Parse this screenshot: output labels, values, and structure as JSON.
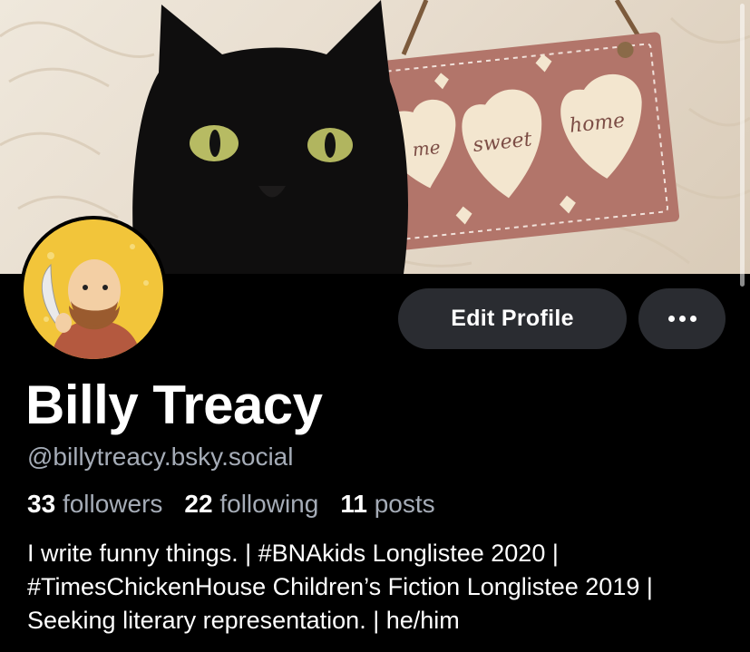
{
  "profile": {
    "display_name": "Billy Treacy",
    "handle": "@billytreacy.bsky.social",
    "bio": "I write funny things. | #BNAkids Longlistee 2020 | #TimesChickenHouse Children’s Fiction Longlistee 2019 | Seeking literary representation. | he/him"
  },
  "stats": {
    "followers_count": "33",
    "followers_label": "followers",
    "following_count": "22",
    "following_label": "following",
    "posts_count": "11",
    "posts_label": "posts"
  },
  "actions": {
    "edit_label": "Edit Profile",
    "more_icon": "ellipsis-icon"
  },
  "banner": {
    "sign_words": [
      "me",
      "sweet",
      "home"
    ]
  },
  "colors": {
    "background": "#000000",
    "button_bg": "#2a2c31",
    "muted_text": "#a5acb7",
    "avatar_bg": "#f2c53a"
  }
}
